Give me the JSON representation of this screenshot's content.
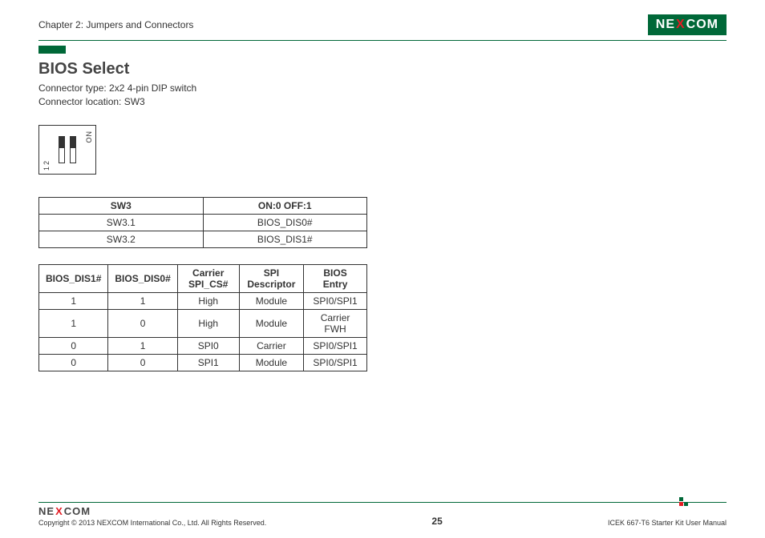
{
  "header": {
    "chapter": "Chapter 2: Jumpers and Connectors",
    "logo_pre": "NE",
    "logo_x": "X",
    "logo_post": "COM"
  },
  "section": {
    "title": "BIOS Select",
    "connector_type": "Connector type: 2x2 4-pin DIP switch",
    "connector_location": "Connector location: SW3"
  },
  "dip": {
    "on_label": "ON",
    "num1": "1",
    "num2": "2"
  },
  "table1": {
    "headers": [
      "SW3",
      "ON:0 OFF:1"
    ],
    "rows": [
      [
        "SW3.1",
        "BIOS_DIS0#"
      ],
      [
        "SW3.2",
        "BIOS_DIS1#"
      ]
    ]
  },
  "table2": {
    "headers": [
      "BIOS_DIS1#",
      "BIOS_DIS0#",
      "Carrier SPI_CS#",
      "SPI Descriptor",
      "BIOS Entry"
    ],
    "rows": [
      [
        "1",
        "1",
        "High",
        "Module",
        "SPI0/SPI1"
      ],
      [
        "1",
        "0",
        "High",
        "Module",
        "Carrier FWH"
      ],
      [
        "0",
        "1",
        "SPI0",
        "Carrier",
        "SPI0/SPI1"
      ],
      [
        "0",
        "0",
        "SPI1",
        "Module",
        "SPI0/SPI1"
      ]
    ]
  },
  "footer": {
    "copyright": "Copyright © 2013 NEXCOM International Co., Ltd. All Rights Reserved.",
    "page": "25",
    "manual": "ICEK 667-T6 Starter Kit User Manual",
    "logo_pre": "NE",
    "logo_x": "X",
    "logo_post": "COM"
  }
}
